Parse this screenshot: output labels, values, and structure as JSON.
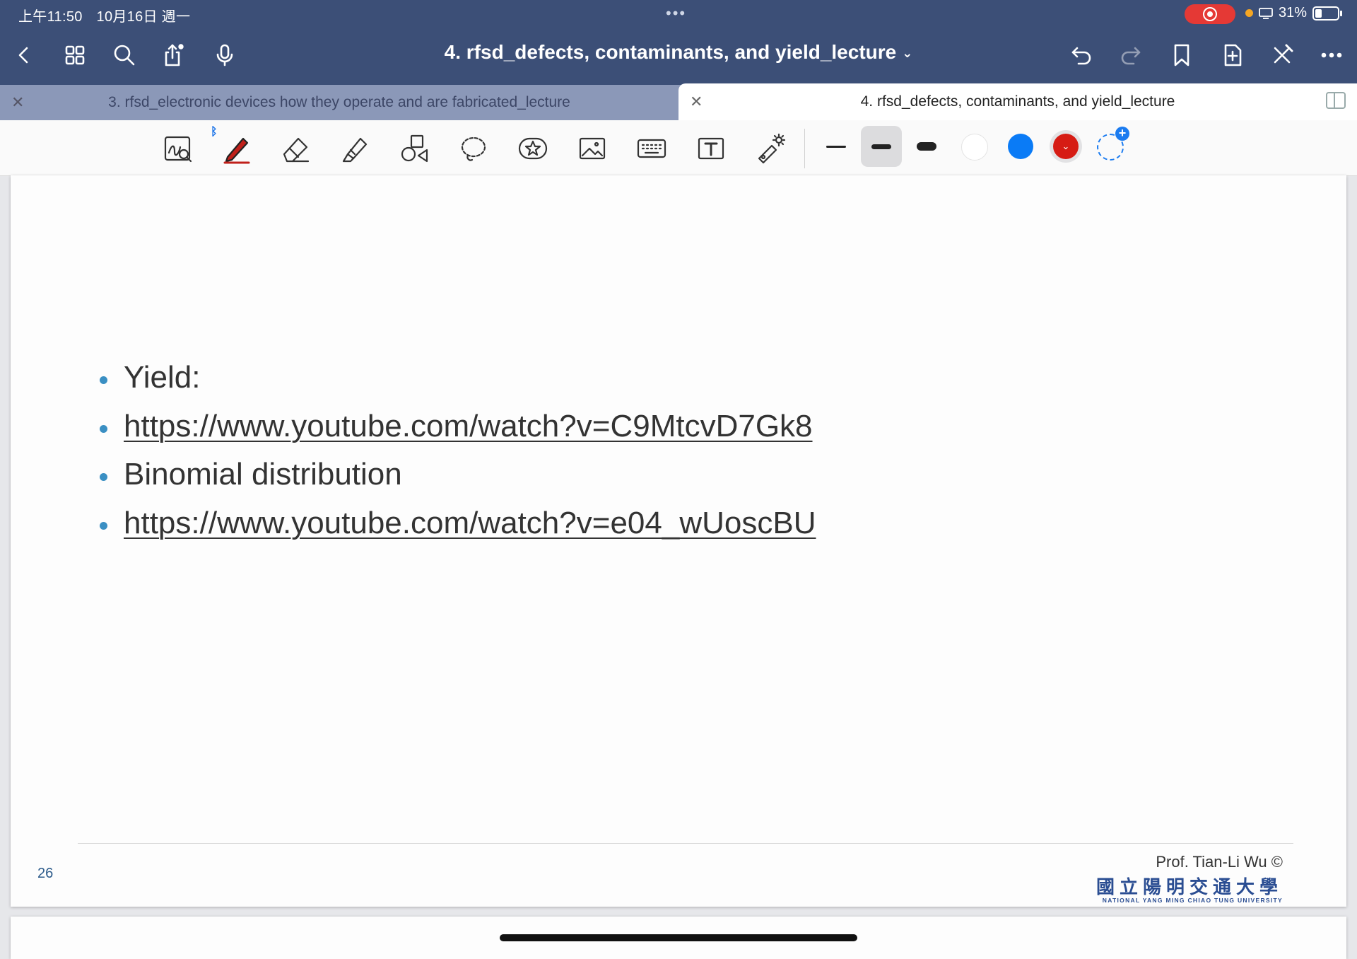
{
  "status_bar": {
    "time": "上午11:50",
    "date": "10月16日 週一",
    "battery": "31%"
  },
  "title_bar": {
    "title": "4. rfsd_defects, contaminants, and yield_lecture"
  },
  "tabs": [
    {
      "label": "3. rfsd_electronic devices how they operate and are fabricated_lecture",
      "active": false
    },
    {
      "label": "4. rfsd_defects, contaminants, and yield_lecture",
      "active": true
    }
  ],
  "toolbar": {
    "tools": [
      "zoom-window",
      "pen",
      "eraser",
      "highlighter",
      "shapes",
      "lasso",
      "sticker",
      "image",
      "keyboard",
      "text",
      "laser-pointer"
    ],
    "selected_tool": "pen",
    "stroke_widths": [
      "thin",
      "medium",
      "thick"
    ],
    "selected_stroke": "medium",
    "colors": [
      "#ffffff",
      "#0a7bf6",
      "#d61c14"
    ],
    "selected_color": "#d61c14"
  },
  "slide": {
    "bullets": [
      {
        "text": "Yield:",
        "link": false
      },
      {
        "text": "https://www.youtube.com/watch?v=C9MtcvD7Gk8",
        "link": true
      },
      {
        "text": "Binomial distribution",
        "link": false
      },
      {
        "text": "https://www.youtube.com/watch?v=e04_wUoscBU",
        "link": true
      }
    ],
    "page_number": "26",
    "credit": "Prof. Tian-Li Wu ©",
    "university_cn": "國立陽明交通大學",
    "university_en": "NATIONAL YANG MING CHIAO TUNG UNIVERSITY"
  }
}
